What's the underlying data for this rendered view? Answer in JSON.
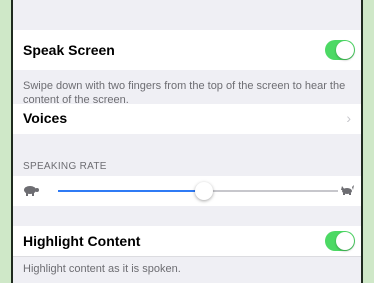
{
  "speak_screen": {
    "title": "Speak Screen",
    "enabled": true,
    "footer": "Swipe down with two fingers from the top of the screen to hear the content of the screen."
  },
  "voices": {
    "label": "Voices",
    "chevron": "chevron-right-icon"
  },
  "speaking_rate": {
    "header": "SPEAKING RATE",
    "value": 0.52,
    "slow_icon": "turtle-icon",
    "fast_icon": "hare-icon"
  },
  "highlight_content": {
    "title": "Highlight Content",
    "enabled": true,
    "footer": "Highlight content as it is spoken."
  },
  "colors": {
    "toggle_on": "#4cd964",
    "slider_fill": "#2f7bf5",
    "panel_bg": "#efeff4",
    "outer_bg": "#cfe8c8"
  }
}
